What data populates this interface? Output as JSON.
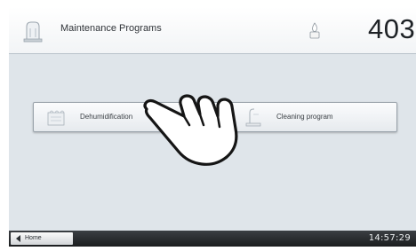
{
  "header": {
    "title": "Maintenance Programs",
    "temperature": "403°",
    "app_icon": "furnace-icon",
    "status_icon": "flame-icon"
  },
  "programs": [
    {
      "label": "Dehumidification",
      "icon": "dehumidification-icon"
    },
    {
      "label": "Cleaning program",
      "icon": "cleaning-program-icon"
    }
  ],
  "footer": {
    "home_label": "Home",
    "home_icon": "arrow-left-icon",
    "clock": "14:57:29"
  },
  "overlay": {
    "icon": "pointing-hand-icon"
  },
  "colors": {
    "screen_bg": "#dfe5ea",
    "header_bg": "#ffffff",
    "footer_bg": "#1b1d1f"
  }
}
